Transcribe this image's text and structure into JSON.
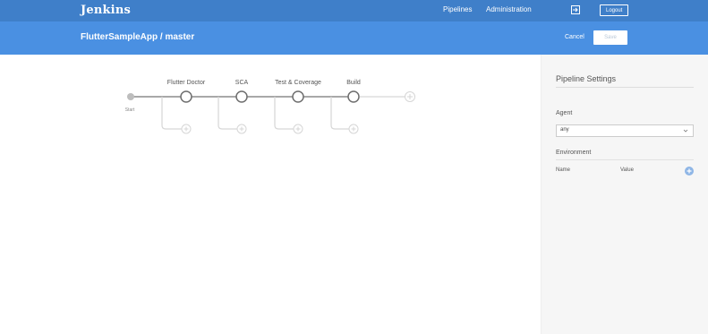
{
  "topbar": {
    "brand": "Jenkins",
    "nav": {
      "pipelines": "Pipelines",
      "administration": "Administration"
    },
    "logout": "Logout",
    "colors": {
      "background": "#3f7fc9"
    }
  },
  "header": {
    "title": "FlutterSampleApp / master",
    "cancel": "Cancel",
    "save": "Save",
    "colors": {
      "background": "#4a90e2"
    }
  },
  "pipeline": {
    "start_label": "Start",
    "stages": [
      {
        "label": "Flutter Doctor"
      },
      {
        "label": "SCA"
      },
      {
        "label": "Test & Coverage"
      },
      {
        "label": "Build"
      }
    ]
  },
  "settings": {
    "title": "Pipeline Settings",
    "agent_label": "Agent",
    "agent_value": "any",
    "environment_label": "Environment",
    "columns": {
      "name": "Name",
      "value": "Value"
    }
  }
}
